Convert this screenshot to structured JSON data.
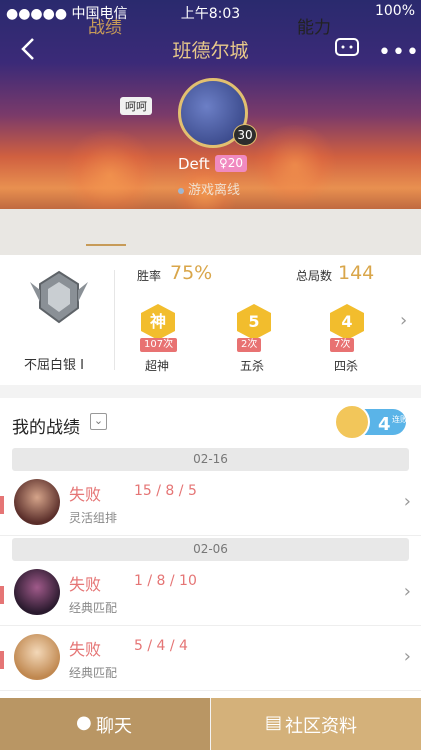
{
  "status_bar": {
    "carrier": "●●●●● 中国电信",
    "wifi": "",
    "time": "上午8:03",
    "battery": "100%"
  },
  "header": {
    "title": "班德尔城",
    "bubble": "呵呵",
    "level": "30",
    "player_name": "Deft",
    "tag": "♀20",
    "status": "游戏离线"
  },
  "tabs": [
    {
      "label": "战绩"
    },
    {
      "label": "能力"
    }
  ],
  "stats": {
    "rank": "不屈白银 I",
    "win_rate_label": "胜率",
    "win_rate": "75%",
    "total_label": "总局数",
    "total": "144",
    "badges": [
      {
        "glyph": "神",
        "count": "107次",
        "name": "超神"
      },
      {
        "glyph": "5",
        "count": "2次",
        "name": "五杀"
      },
      {
        "glyph": "4",
        "count": "7次",
        "name": "四杀"
      }
    ]
  },
  "history": {
    "title": "我的战绩",
    "streak": "4",
    "streak_text": "连败",
    "dates": [
      "02-16",
      "02-06"
    ],
    "rows": [
      {
        "result": "失败",
        "kda": "15 / 8 / 5",
        "mode": "灵活组排"
      },
      {
        "result": "失败",
        "kda": "1 / 8 / 10",
        "mode": "经典匹配"
      },
      {
        "result": "失败",
        "kda": "5 / 4 / 4",
        "mode": "经典匹配"
      }
    ]
  },
  "bottom": {
    "chat": "聊天",
    "profile": "社区资料"
  }
}
